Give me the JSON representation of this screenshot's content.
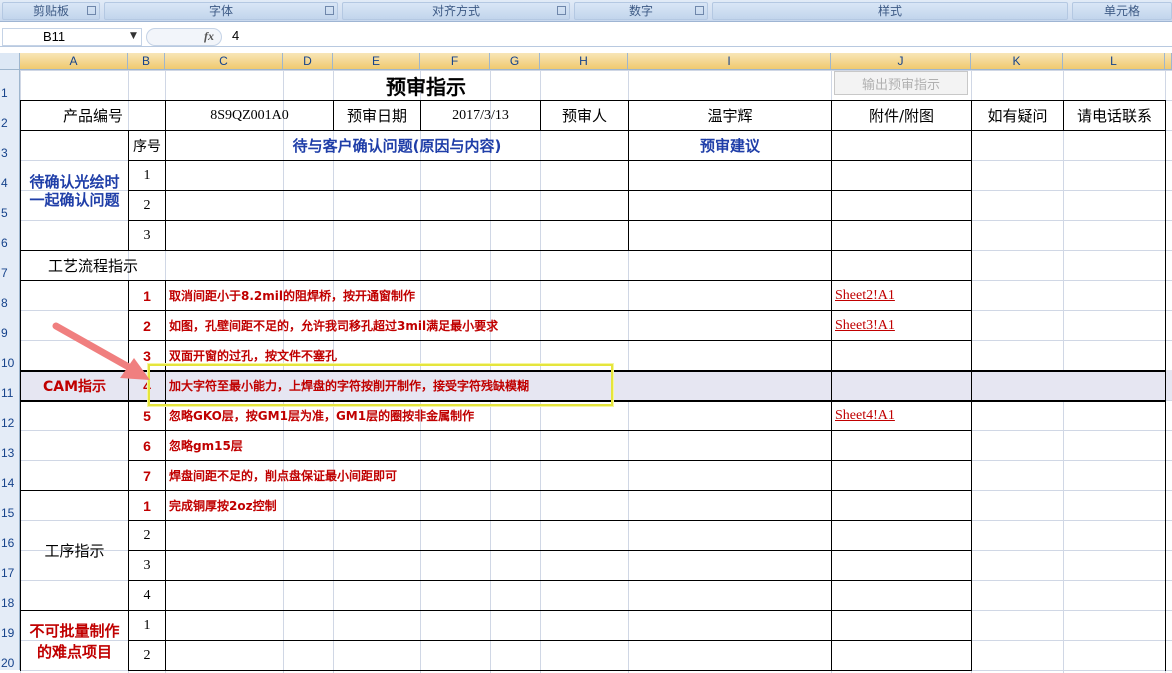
{
  "ribbon": {
    "groups": [
      "剪贴板",
      "字体",
      "对齐方式",
      "数字",
      "样式",
      "单元格"
    ]
  },
  "formula_bar": {
    "name_box": "B11",
    "fx_label": "fx",
    "value": "4"
  },
  "columns": [
    "A",
    "B",
    "C",
    "D",
    "E",
    "F",
    "G",
    "H",
    "I",
    "J",
    "K",
    "L"
  ],
  "rows": [
    "1",
    "2",
    "3",
    "4",
    "5",
    "6",
    "7",
    "8",
    "9",
    "10",
    "11",
    "12",
    "13",
    "14",
    "15",
    "16",
    "17",
    "18",
    "19",
    "20"
  ],
  "sheet": {
    "title": "预审指示",
    "output_button": "输出预审指示",
    "product_no_label": "产品编号",
    "product_no": "8S9QZ001A0",
    "review_date_label": "预审日期",
    "review_date": "2017/3/13",
    "reviewer_label": "预审人",
    "reviewer": "温宇辉",
    "attachment_label": "附件/附图",
    "contact_q": "如有疑问",
    "contact_call": "请电话联系",
    "pending_section": "待确认光绘时一起确认问题",
    "seq_label": "序号",
    "pending_issue_label": "待与客户确认问题(原因与内容)",
    "advice_label": "预审建议",
    "pending_rows": [
      "1",
      "2",
      "3"
    ],
    "process_flow_label": "工艺流程指示",
    "cam_label": "CAM指示",
    "cam_items": [
      {
        "no": "1",
        "text": "取消间距小于8.2mil的阻焊桥，按开通窗制作",
        "link": "Sheet2!A1"
      },
      {
        "no": "2",
        "text": "如图，孔壁间距不足的，允许我司移孔超过3mil满足最小要求",
        "link": "Sheet3!A1"
      },
      {
        "no": "3",
        "text": "双面开窗的过孔，按文件不塞孔",
        "link": ""
      },
      {
        "no": "4",
        "text": "加大字符至最小能力，上焊盘的字符按削开制作，接受字符残缺模糊",
        "link": ""
      },
      {
        "no": "5",
        "text": "忽略GKO层，按GM1层为准，GM1层的圈按非金属制作",
        "link": "Sheet4!A1"
      },
      {
        "no": "6",
        "text": "忽略gm15层",
        "link": ""
      },
      {
        "no": "7",
        "text": "焊盘间距不足的，削点盘保证最小间距即可",
        "link": ""
      }
    ],
    "process_label": "工序指示",
    "process_items": [
      {
        "no": "1",
        "text": "完成铜厚按2oz控制"
      },
      {
        "no": "2",
        "text": ""
      },
      {
        "no": "3",
        "text": ""
      },
      {
        "no": "4",
        "text": ""
      }
    ],
    "difficult_label": "不可批量制作的难点项目",
    "difficult_rows": [
      "1",
      "2"
    ]
  },
  "colors": {
    "accent_blue": "#1f3ea8",
    "alert_red": "#c00000",
    "header_gold": "#f0c96f",
    "highlight_yellow": "#e5e53c"
  }
}
